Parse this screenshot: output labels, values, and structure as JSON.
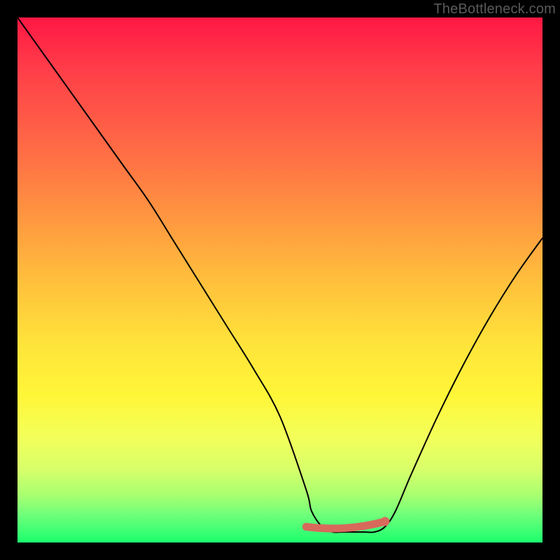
{
  "watermark": "TheBottleneck.com",
  "chart_data": {
    "type": "line",
    "title": "",
    "xlabel": "",
    "ylabel": "",
    "xlim": [
      0,
      100
    ],
    "ylim": [
      0,
      100
    ],
    "series": [
      {
        "name": "bottleneck-curve",
        "x": [
          0,
          5,
          10,
          15,
          20,
          25,
          30,
          35,
          40,
          45,
          50,
          55,
          56,
          58,
          60,
          62,
          64,
          66,
          68,
          70,
          72,
          75,
          80,
          85,
          90,
          95,
          100
        ],
        "y": [
          100,
          93,
          86,
          79,
          72,
          65,
          57,
          49,
          41,
          33,
          24,
          10,
          6,
          3,
          2,
          2,
          2,
          2,
          2,
          3,
          6,
          13,
          24,
          34,
          43,
          51,
          58
        ],
        "stroke": "#000000",
        "stroke_width": 2
      }
    ],
    "markers": [
      {
        "name": "optimal-range-marker",
        "x": [
          55,
          70
        ],
        "y": [
          2,
          2
        ],
        "color": "#d86a5c",
        "width": 11
      },
      {
        "name": "optimal-range-left-dot",
        "cx": 55,
        "cy": 3,
        "r": 5.5,
        "color": "#d86a5c"
      },
      {
        "name": "optimal-range-right-dot",
        "cx": 70,
        "cy": 4,
        "r": 6.5,
        "color": "#d86a5c"
      }
    ]
  }
}
